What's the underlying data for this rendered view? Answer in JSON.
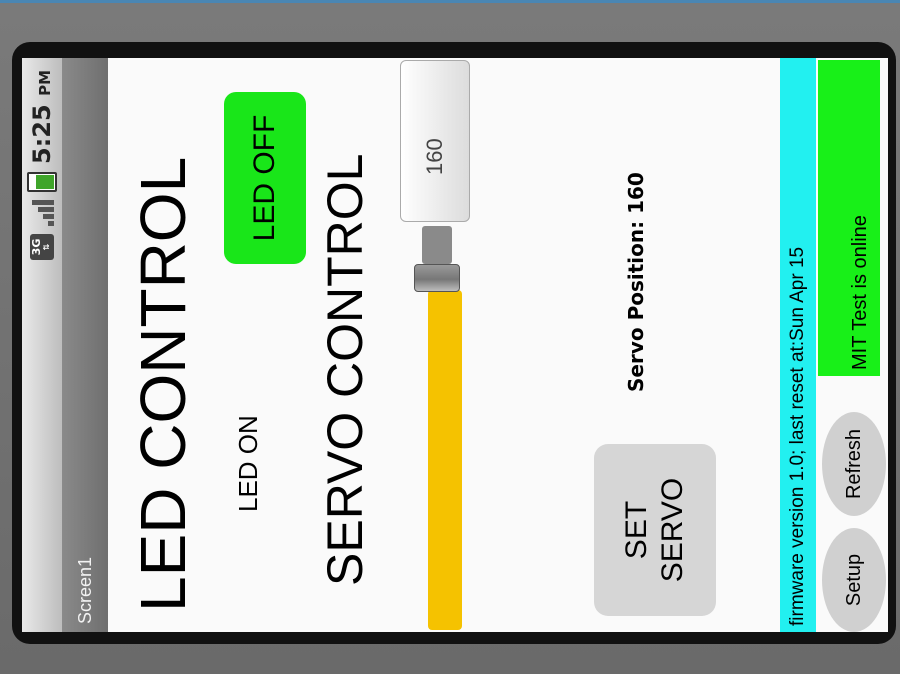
{
  "status_bar": {
    "network": "3G",
    "time": "5:25",
    "ampm": "PM"
  },
  "title_bar": {
    "title": "Screen1"
  },
  "led": {
    "heading": "LED CONTROL",
    "status": "LED ON",
    "toggle_label": "LED OFF"
  },
  "servo": {
    "heading": "SERVO CONTROL",
    "slider_value": 160,
    "input_value": "160",
    "position_text": "Servo Position: 160",
    "set_button_label": "SET\nSERVO"
  },
  "info": {
    "firmware_text": "firmware version 1.0; last reset at:Sun Apr 15"
  },
  "bottom": {
    "setup_label": "Setup",
    "refresh_label": "Refresh",
    "online_text": "MIT Test is online"
  },
  "colors": {
    "led_button": "#19e619",
    "slider_fill": "#f5c200",
    "info_bar": "#22f0f0",
    "online_badge": "#18f018"
  }
}
